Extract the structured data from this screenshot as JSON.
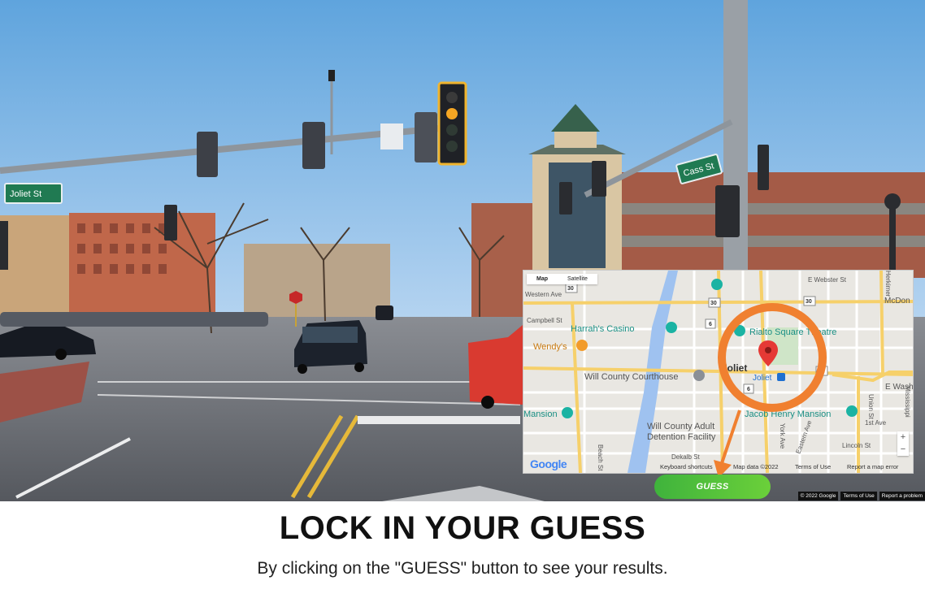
{
  "street_signs": {
    "left": "Joliet St",
    "right": "Cass St"
  },
  "map": {
    "tabs": [
      "Map",
      "Satellite"
    ],
    "places": {
      "harrahs": "Harrah's Casino",
      "rialto": "Rialto Square Theatre",
      "wendys": "Wendy's",
      "courthouse": "Will County Courthouse",
      "joliet": "Joliet",
      "joliet_station": "Joliet",
      "mansion_left": "Mansion",
      "jacob": "Jacob Henry Mansion",
      "detention": "Will County Adult Detention Facility",
      "detention_l1": "Will County Adult",
      "detention_l2": "Detention Facility"
    },
    "streets": {
      "western": "Western Ave",
      "campbell": "Campbell St",
      "e_webster": "E Webster St",
      "mcdon": "McDon",
      "e_washi": "E Washi",
      "union": "Union St",
      "first_ave": "1st Ave",
      "lincoln": "Lincoln St",
      "dekalb": "Dekalb St",
      "beach": "Beach St",
      "york": "York Ave",
      "eastern": "Eastern Ave",
      "herkimer": "Herkimer",
      "mississippi": "Mississippi"
    },
    "route_shields": [
      "30",
      "30",
      "30",
      "6",
      "6",
      "30"
    ],
    "zoom_in": "+",
    "zoom_out": "−",
    "footer": {
      "logo": "Google",
      "keyboard": "Keyboard shortcuts",
      "map_data": "Map data ©2022",
      "terms": "Terms of Use",
      "report": "Report a map error"
    }
  },
  "guess_button": "GUESS",
  "streetview_footer": [
    "© 2022 Google",
    "Terms of Use",
    "Report a problem"
  ],
  "heading": "LOCK IN YOUR GUESS",
  "subheading": "By clicking on the \"GUESS\" button to see your results.",
  "colors": {
    "accent_orange": "#f08030",
    "guess_green": "#4cbb3a",
    "pin_red": "#e53935",
    "road_yellow": "#f6d06a",
    "river_blue": "#9fc2f0"
  },
  "icons": [
    "map-pin-icon",
    "annotation-arrow-icon",
    "traffic-light-icon",
    "casino-icon",
    "theatre-icon",
    "restaurant-icon",
    "courthouse-icon",
    "train-station-icon",
    "museum-icon"
  ]
}
